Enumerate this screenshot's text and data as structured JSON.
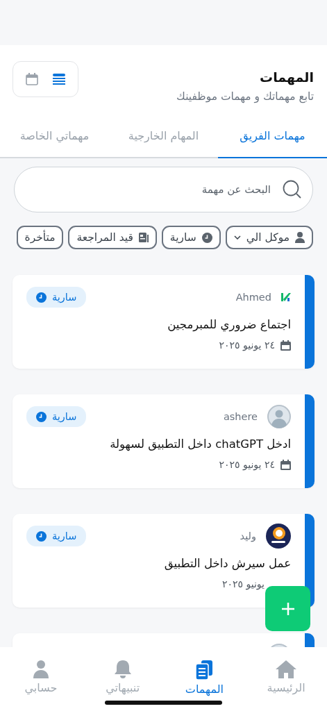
{
  "header": {
    "title": "المهمات",
    "subtitle": "تابع مهماتك و مهمات موظفينك"
  },
  "view_toggle": [
    {
      "kind": "list",
      "selected": true
    },
    {
      "kind": "calendar",
      "selected": false
    }
  ],
  "tabs": [
    {
      "label": "مهمات الفريق",
      "selected": true
    },
    {
      "label": "المهام الخارجية",
      "selected": false
    },
    {
      "label": "مهماتي الخاصة",
      "selected": false
    }
  ],
  "search": {
    "placeholder": "البحث عن مهمة"
  },
  "filters": [
    {
      "label": "موكل الي",
      "kind": "assignee"
    },
    {
      "label": "سارية",
      "kind": "active"
    },
    {
      "label": "قيد المراجعة",
      "kind": "review"
    },
    {
      "label": "متأخرة",
      "kind": "late"
    }
  ],
  "tasks": [
    {
      "kind": "mark",
      "assignee": "Ahmed",
      "status": "سارية",
      "title": "اجتماع ضروري للمبرمجين",
      "date": "٢٤ يونيو ٢٠٢٥",
      "date_icon": true
    },
    {
      "kind": "photo",
      "assignee": "ashere",
      "status": "سارية",
      "title": "ادخل chatGPT داخل التطبيق لسهولة",
      "date": "٢٤ يونيو ٢٠٢٥",
      "date_icon": true
    },
    {
      "kind": "brand",
      "assignee": "وليد",
      "status": "سارية",
      "title": "عمل سيرش داخل التطبيق",
      "date": "يونيو ٢٠٢٥",
      "date_icon": false
    },
    {
      "kind": "photo"
    }
  ],
  "nav": [
    {
      "label": "الرئيسية",
      "kind": "home",
      "selected": false
    },
    {
      "label": "المهمات",
      "kind": "tasks",
      "selected": true
    },
    {
      "label": "تنبيهاتي",
      "kind": "alerts",
      "selected": false
    },
    {
      "label": "حسابي",
      "kind": "account",
      "selected": false
    }
  ]
}
